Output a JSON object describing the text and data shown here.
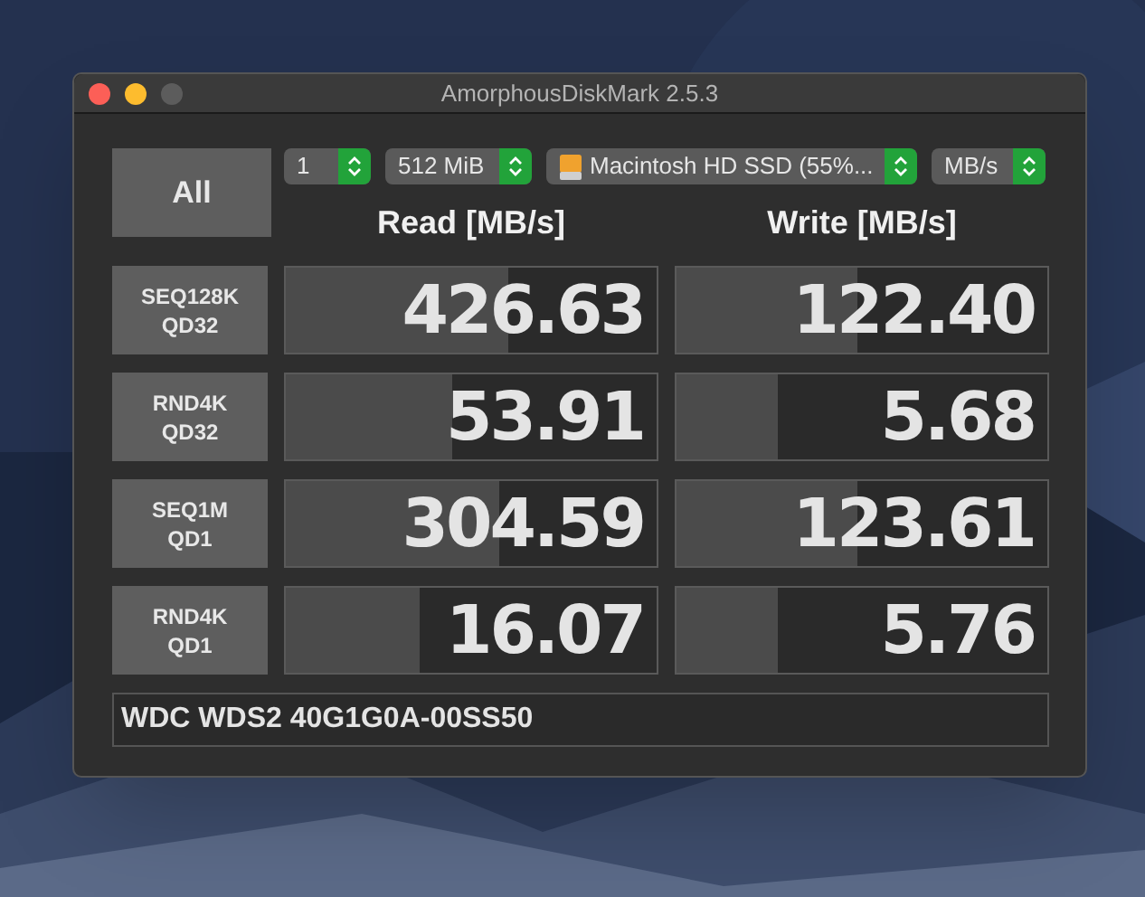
{
  "window": {
    "title": "AmorphousDiskMark 2.5.3"
  },
  "all_button": "All",
  "selectors": [
    {
      "kind": "count",
      "value": "1"
    },
    {
      "kind": "size",
      "value": "512 MiB"
    },
    {
      "kind": "drive",
      "value": "Macintosh HD SSD (55%..."
    },
    {
      "kind": "unit",
      "value": "MB/s"
    }
  ],
  "columns": [
    "Read [MB/s]",
    "Write [MB/s]"
  ],
  "rows": [
    {
      "label": [
        "SEQ128K",
        "QD32"
      ],
      "read": {
        "value": "426.63",
        "level": 0.6
      },
      "write": {
        "value": "122.40",
        "level": 0.49
      }
    },
    {
      "label": [
        "RND4K",
        "QD32"
      ],
      "read": {
        "value": "53.91",
        "level": 0.45
      },
      "write": {
        "value": "5.68",
        "level": 0.275
      }
    },
    {
      "label": [
        "SEQ1M",
        "QD1"
      ],
      "read": {
        "value": "304.59",
        "level": 0.575
      },
      "write": {
        "value": "123.61",
        "level": 0.49
      }
    },
    {
      "label": [
        "RND4K",
        "QD1"
      ],
      "read": {
        "value": "16.07",
        "level": 0.36
      },
      "write": {
        "value": "5.76",
        "level": 0.275
      }
    }
  ],
  "drive_info": "WDC WDS2 40G1G0A-00SS50"
}
